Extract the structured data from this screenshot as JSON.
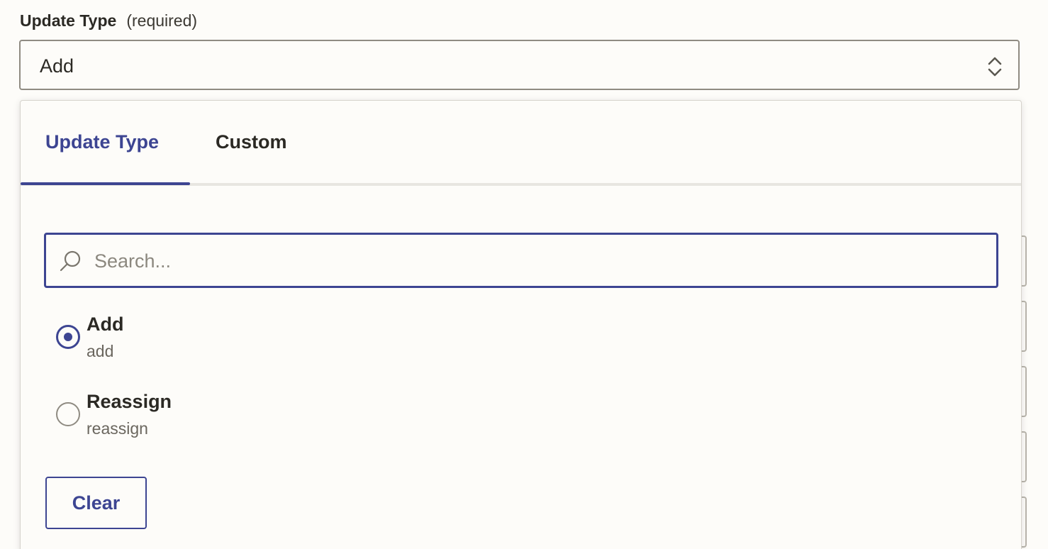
{
  "field": {
    "label": "Update Type",
    "required_text": "(required)",
    "selected_value": "Add"
  },
  "dropdown": {
    "tabs": [
      {
        "label": "Update Type",
        "active": true
      },
      {
        "label": "Custom",
        "active": false
      }
    ],
    "search": {
      "placeholder": "Search...",
      "value": ""
    },
    "options": [
      {
        "label": "Add",
        "value": "add",
        "selected": true
      },
      {
        "label": "Reassign",
        "value": "reassign",
        "selected": false
      }
    ],
    "clear_label": "Clear"
  },
  "colors": {
    "accent": "#3d4592",
    "text": "#2b2924",
    "muted": "#6a665e",
    "border": "#8f8b82",
    "background": "#fdfcf9"
  },
  "icons": {
    "select_chevron": "chevron-up-down-icon",
    "search": "search-icon"
  }
}
